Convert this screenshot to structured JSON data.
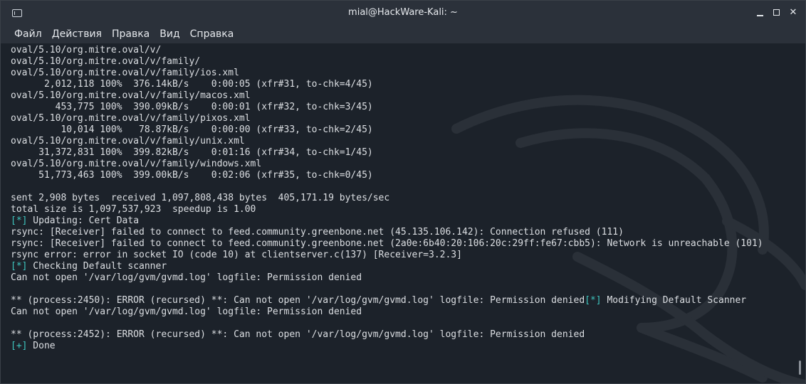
{
  "window": {
    "title": "mial@HackWare-Kali: ~",
    "controls": {
      "minimize": "minimize",
      "maximize": "maximize",
      "close": "✕"
    }
  },
  "menu": [
    "Файл",
    "Действия",
    "Правка",
    "Вид",
    "Справка"
  ],
  "terminal_lines": [
    {
      "text": "oval/5.10/org.mitre.oval/v/"
    },
    {
      "text": "oval/5.10/org.mitre.oval/v/family/"
    },
    {
      "text": "oval/5.10/org.mitre.oval/v/family/ios.xml"
    },
    {
      "text": "      2,012,118 100%  376.14kB/s    0:00:05 (xfr#31, to-chk=4/45)"
    },
    {
      "text": "oval/5.10/org.mitre.oval/v/family/macos.xml"
    },
    {
      "text": "        453,775 100%  390.09kB/s    0:00:01 (xfr#32, to-chk=3/45)"
    },
    {
      "text": "oval/5.10/org.mitre.oval/v/family/pixos.xml"
    },
    {
      "text": "         10,014 100%   78.87kB/s    0:00:00 (xfr#33, to-chk=2/45)"
    },
    {
      "text": "oval/5.10/org.mitre.oval/v/family/unix.xml"
    },
    {
      "text": "     31,372,831 100%  399.82kB/s    0:01:16 (xfr#34, to-chk=1/45)"
    },
    {
      "text": "oval/5.10/org.mitre.oval/v/family/windows.xml"
    },
    {
      "text": "     51,773,463 100%  399.00kB/s    0:02:06 (xfr#35, to-chk=0/45)"
    },
    {
      "text": ""
    },
    {
      "text": "sent 2,908 bytes  received 1,097,808,438 bytes  405,171.19 bytes/sec"
    },
    {
      "text": "total size is 1,097,537,923  speedup is 1.00"
    },
    {
      "prefix": "[*]",
      "text": " Updating: Cert Data"
    },
    {
      "text": "rsync: [Receiver] failed to connect to feed.community.greenbone.net (45.135.106.142): Connection refused (111)"
    },
    {
      "text": "rsync: [Receiver] failed to connect to feed.community.greenbone.net (2a0e:6b40:20:106:20c:29ff:fe67:cbb5): Network is unreachable (101)"
    },
    {
      "text": "rsync error: error in socket IO (code 10) at clientserver.c(137) [Receiver=3.2.3]"
    },
    {
      "prefix": "[*]",
      "text": " Checking Default scanner"
    },
    {
      "text": "Can not open '/var/log/gvm/gvmd.log' logfile: Permission denied"
    },
    {
      "text": ""
    },
    {
      "text": "** (process:2450): ERROR (recursed) **: Can not open '/var/log/gvm/gvmd.log' logfile: Permission denied",
      "suffix_tag": "[*]",
      "suffix": " Modifying Default Scanner"
    },
    {
      "text": "Can not open '/var/log/gvm/gvmd.log' logfile: Permission denied"
    },
    {
      "text": ""
    },
    {
      "text": "** (process:2452): ERROR (recursed) **: Can not open '/var/log/gvm/gvmd.log' logfile: Permission denied"
    },
    {
      "prefix": "[+]",
      "text": " Done"
    }
  ],
  "colors": {
    "tag": "#3ec7c0",
    "text": "#dcdfe3",
    "background": "#1c222a"
  }
}
